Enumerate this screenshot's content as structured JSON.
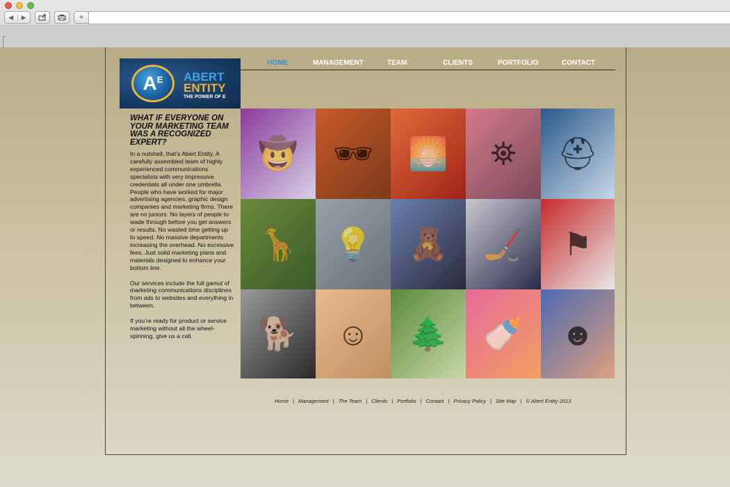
{
  "browser": {
    "back_label": "◀",
    "forward_label": "▶",
    "share_icon": "share-icon",
    "print_icon": "print-icon",
    "new_tab_label": "+",
    "url": ""
  },
  "logo": {
    "mark": "A",
    "mark_sup": "E",
    "name_line1": "ABERT",
    "name_line2": "ENTITY",
    "tagline": "THE POWER OF E"
  },
  "nav": {
    "items": [
      {
        "label": "HOME",
        "active": true
      },
      {
        "label": "MANAGEMENT",
        "active": false
      },
      {
        "label": "TEAM",
        "active": false
      },
      {
        "label": "CLIENTS",
        "active": false
      },
      {
        "label": "PORTFOLIO",
        "active": false
      },
      {
        "label": "CONTACT",
        "active": false
      }
    ]
  },
  "content": {
    "heading": "WHAT IF EVERYONE ON YOUR MARKETING TEAM WAS A RECOGNIZED EXPERT?",
    "paragraphs": [
      "In a nutshell, that’s Abert Entity. A carefully assembled team of highly experienced communications specialists with very impressive credentials all under one umbrella. People who have worked for major advertising agencies, graphic design companies and marketing firms. There are no juniors. No layers of people to wade through before you get answers or results. No wasted time getting up to speed. No massive departments increasing the overhead. No excessive fees. Just solid marketing plans and materials designed to enhance your bottom line.",
      "Our services include the full gamut of marketing communications disciplines from ads to websites and everything in between.",
      "If you’re ready for product or service marketing without all the wheel-spinning, give us a call."
    ]
  },
  "gallery": [
    {
      "name": "cowboy-map-tile",
      "icon": "cowboy-icon",
      "colors": [
        "#8a3a9a",
        "#d8d0e8"
      ]
    },
    {
      "name": "sunglasses-man-tile",
      "icon": "sunglasses-icon",
      "colors": [
        "#c85a28",
        "#7a3a1a"
      ]
    },
    {
      "name": "sunset-sea-tile",
      "icon": "sunset-icon",
      "colors": [
        "#e06a3a",
        "#a02418"
      ]
    },
    {
      "name": "lighthouse-tile",
      "icon": "lighthouse-icon",
      "colors": [
        "#d47a8a",
        "#7a4a5a"
      ]
    },
    {
      "name": "astronaut-helmet-tile",
      "icon": "helmet-icon",
      "colors": [
        "#2a5a8a",
        "#c8d8e8"
      ]
    },
    {
      "name": "giraffe-tile",
      "icon": "giraffe-icon",
      "colors": [
        "#6a8a3a",
        "#3a5a2a"
      ]
    },
    {
      "name": "glass-lightbulb-tile",
      "icon": "lightbulb-icon",
      "colors": [
        "#9aa0a8",
        "#6a7078"
      ]
    },
    {
      "name": "plush-toys-tile",
      "icon": "plush-icon",
      "colors": [
        "#6a80b0",
        "#2a2a3a"
      ]
    },
    {
      "name": "hockey-players-tile",
      "icon": "hockey-icon",
      "colors": [
        "#c8c8d0",
        "#2a2a4a"
      ]
    },
    {
      "name": "flag-camera-tile",
      "icon": "flag-icon",
      "colors": [
        "#c82a2a",
        "#e8e8e8"
      ]
    },
    {
      "name": "dog-tile",
      "icon": "dog-icon",
      "colors": [
        "#9a9a9a",
        "#2a2a2a"
      ]
    },
    {
      "name": "woman-smiling-tile",
      "icon": "woman-icon",
      "colors": [
        "#e8b890",
        "#c09060"
      ]
    },
    {
      "name": "birch-forest-tile",
      "icon": "forest-icon",
      "colors": [
        "#5a8a3a",
        "#c8d8a8"
      ]
    },
    {
      "name": "baby-bottle-tile",
      "icon": "bottle-icon",
      "colors": [
        "#e86a9a",
        "#f0a060"
      ]
    },
    {
      "name": "smiling-girl-tile",
      "icon": "girl-icon",
      "colors": [
        "#4a6ab0",
        "#e0a080"
      ]
    }
  ],
  "footer": {
    "links": [
      "Home",
      "Management",
      "The Team",
      "Clients",
      "Portfolio",
      "Contact",
      "Privacy Policy",
      "Site Map"
    ],
    "copyright": "© Abert Entity 2013",
    "separator": "|"
  },
  "colors": {
    "nav_active": "#3d8ed6",
    "nav_text": "#ffffff",
    "logo_gold": "#e7b53c",
    "logo_blue": "#3ea2e8"
  }
}
